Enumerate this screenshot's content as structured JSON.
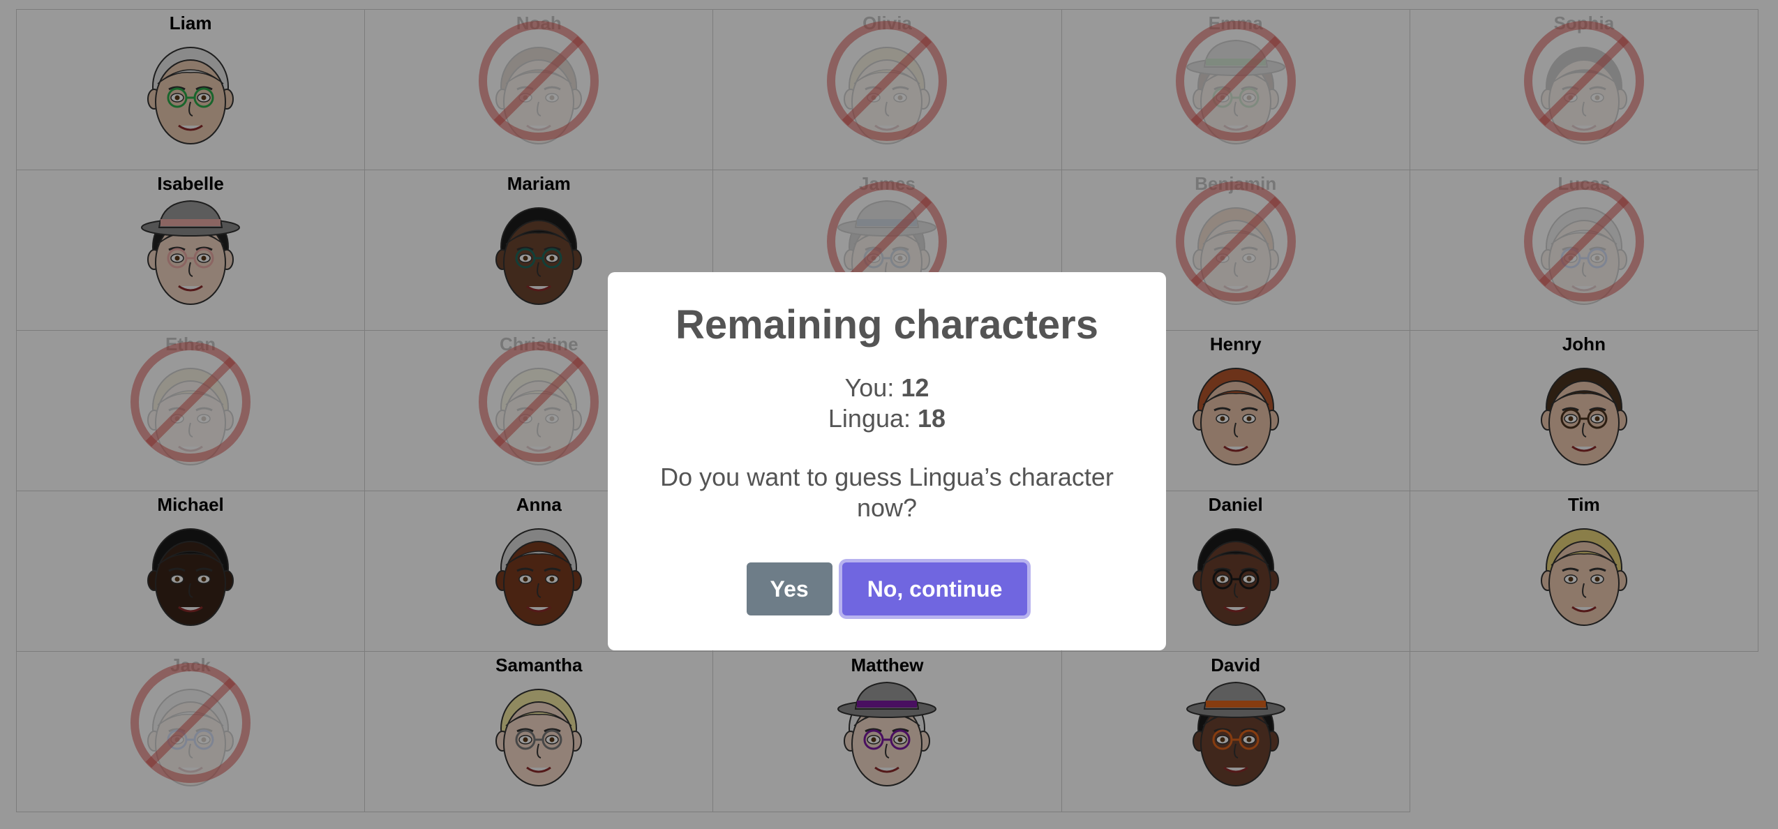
{
  "board": {
    "characters": [
      {
        "name": "Liam",
        "eliminated": false,
        "skin": "#e8c9b0",
        "hair": "#e6e6e6",
        "accent": "#2aa84a",
        "hat": false
      },
      {
        "name": "Noah",
        "eliminated": true,
        "skin": "#e8c9b0",
        "hair": "#8a6a4a",
        "accent": "",
        "hat": false
      },
      {
        "name": "Olivia",
        "eliminated": true,
        "skin": "#f1d3bd",
        "hair": "#d8c27a",
        "accent": "",
        "hat": false
      },
      {
        "name": "Emma",
        "eliminated": true,
        "skin": "#e8c9b0",
        "hair": "#5a3a2a",
        "accent": "#3f8f3f",
        "hat": true
      },
      {
        "name": "Sophia",
        "eliminated": true,
        "skin": "#e8c9b0",
        "hair": "#333333",
        "accent": "",
        "hat": false
      },
      {
        "name": "Isabelle",
        "eliminated": false,
        "skin": "#efd2c0",
        "hair": "#222222",
        "accent": "#e8a8a4",
        "hat": true
      },
      {
        "name": "Mariam",
        "eliminated": false,
        "skin": "#6b4530",
        "hair": "#1b1b1b",
        "accent": "#1f6a5e",
        "hat": false
      },
      {
        "name": "James",
        "eliminated": true,
        "skin": "#e8c9b0",
        "hair": "#555555",
        "accent": "#3a5a8a",
        "hat": true
      },
      {
        "name": "Benjamin",
        "eliminated": true,
        "skin": "#e8c9b0",
        "hair": "#c7743c",
        "accent": "",
        "hat": false
      },
      {
        "name": "Lucas",
        "eliminated": true,
        "skin": "#e8c9b0",
        "hair": "#bbbbbb",
        "accent": "#3a6ad0",
        "hat": false
      },
      {
        "name": "Ethan",
        "eliminated": true,
        "skin": "#efd2c0",
        "hair": "#d8c27a",
        "accent": "",
        "hat": false
      },
      {
        "name": "Christine",
        "eliminated": true,
        "skin": "#f1d3bd",
        "hair": "#eee3a0",
        "accent": "",
        "hat": false
      },
      {
        "name": "",
        "eliminated": false,
        "skin": "",
        "hair": "",
        "accent": "",
        "hat": false
      },
      {
        "name": "Henry",
        "eliminated": false,
        "skin": "#e8c2a8",
        "hair": "#b5562c",
        "accent": "",
        "hat": false
      },
      {
        "name": "John",
        "eliminated": false,
        "skin": "#ecc7ad",
        "hair": "#4a331f",
        "accent": "#4a331f",
        "hat": false
      },
      {
        "name": "Michael",
        "eliminated": false,
        "skin": "#3a2418",
        "hair": "#1a1a1a",
        "accent": "",
        "hat": false
      },
      {
        "name": "Anna",
        "eliminated": false,
        "skin": "#7a3b1e",
        "hair": "#d9d9d9",
        "accent": "",
        "hat": false
      },
      {
        "name": "",
        "eliminated": false,
        "skin": "",
        "hair": "",
        "accent": "",
        "hat": false
      },
      {
        "name": "Daniel",
        "eliminated": false,
        "skin": "#6a3f2c",
        "hair": "#1a1a1a",
        "accent": "#1a1a1a",
        "hat": false
      },
      {
        "name": "Tim",
        "eliminated": false,
        "skin": "#ecc9b0",
        "hair": "#e6d27a",
        "accent": "",
        "hat": false
      },
      {
        "name": "Jack",
        "eliminated": true,
        "skin": "#e8c9b0",
        "hair": "#cccccc",
        "accent": "#3a6ad0",
        "hat": false
      },
      {
        "name": "Samantha",
        "eliminated": false,
        "skin": "#f3d8c6",
        "hair": "#f0e6a0",
        "accent": "#777777",
        "hat": false
      },
      {
        "name": "Matthew",
        "eliminated": false,
        "skin": "#f0d8c6",
        "hair": "#eeeeee",
        "accent": "#7a1aa0",
        "hat": true
      },
      {
        "name": "David",
        "eliminated": false,
        "skin": "#6b4230",
        "hair": "#1a1a1a",
        "accent": "#e0641c",
        "hat": true
      },
      {
        "name": "",
        "eliminated": false,
        "skin": "",
        "hair": "",
        "accent": "",
        "hat": false
      }
    ]
  },
  "modal": {
    "title": "Remaining characters",
    "you_label": "You:",
    "you_count": "12",
    "lingua_label": "Lingua:",
    "lingua_count": "18",
    "question": "Do you want to guess Lingua’s character now?",
    "yes_label": "Yes",
    "no_label": "No, continue"
  },
  "colors": {
    "overlay": "rgba(0,0,0,0.40)",
    "yes_button": "#6e7d88",
    "no_button": "#7066e0",
    "no_sign": "#d9534f"
  },
  "icons": {
    "eliminated_marker": "prohibited-sign-icon",
    "portrait": "character-face-icon"
  }
}
